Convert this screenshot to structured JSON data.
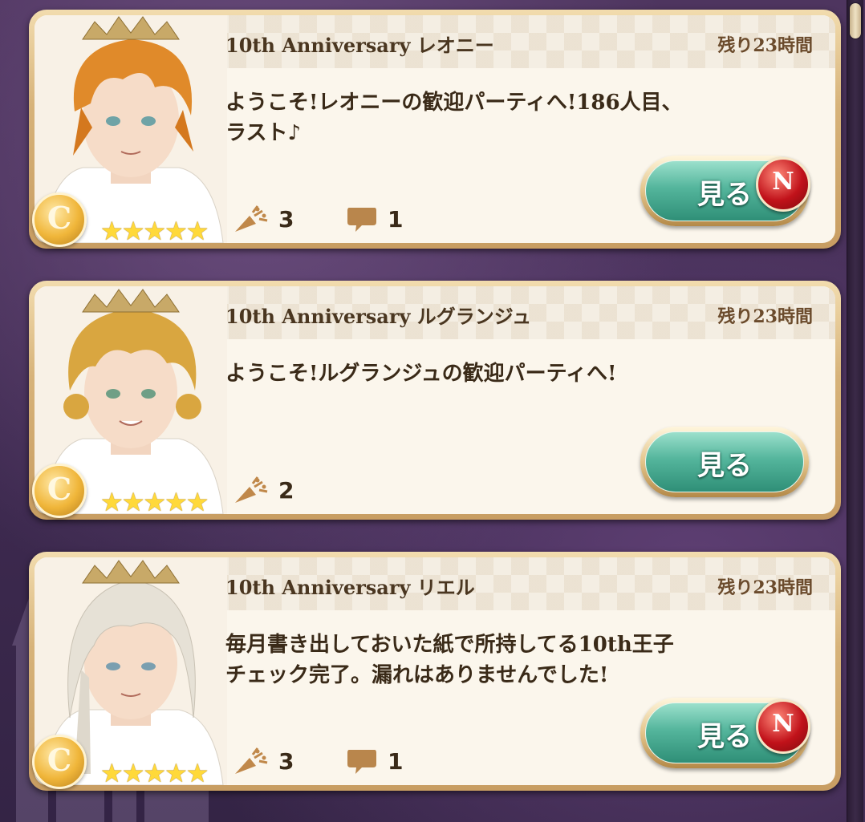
{
  "scrollbar": {
    "label": "scrollbar"
  },
  "cards": [
    {
      "title": "10th Anniversary レオニー",
      "remaining": "残り23時間",
      "message": "ようこそ!レオニーの歓迎パーティへ!186人目、\nラスト♪",
      "rank": "C",
      "stars": "★★★★★",
      "cheers": "3",
      "comments": "1",
      "button_label": "見る",
      "new_badge": "N",
      "hair_color": "#e08a2a"
    },
    {
      "title": "10th Anniversary ルグランジュ",
      "remaining": "残り23時間",
      "message": "ようこそ!ルグランジュの歓迎パーティへ!",
      "rank": "C",
      "stars": "★★★★★",
      "cheers": "2",
      "button_label": "見る",
      "hair_color": "#d9a640"
    },
    {
      "title": "10th Anniversary リエル",
      "remaining": "残り23時間",
      "message": "毎月書き出しておいた紙で所持してる10th王子\nチェック完了。漏れはありませんでした!",
      "rank": "C",
      "stars": "★★★★★",
      "cheers": "3",
      "comments": "1",
      "button_label": "見る",
      "new_badge": "N",
      "hair_color": "#e6e1d6"
    }
  ],
  "colors": {
    "accent_gold": "#d7b37a",
    "button_green": "#54b59c",
    "badge_red": "#c1121a",
    "star_yellow": "#ffd93a"
  },
  "icons": {
    "cheer": "party-popper-icon",
    "comment": "speech-bubble-icon",
    "scroll": "scrollbar-thumb"
  }
}
